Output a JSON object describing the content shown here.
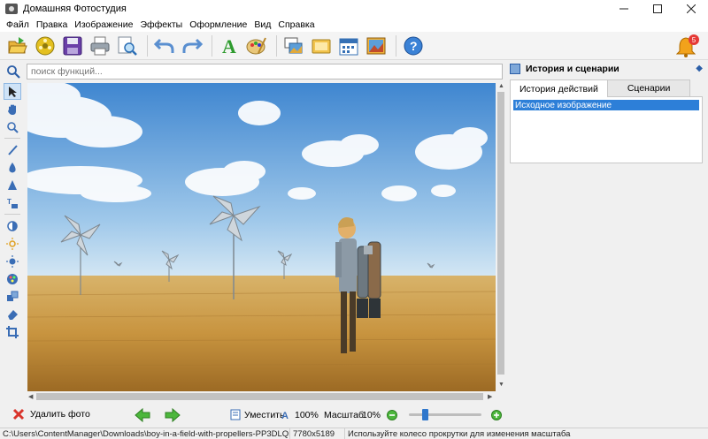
{
  "window": {
    "title": "Домашняя Фотостудия",
    "controls": [
      "minimize",
      "maximize",
      "close"
    ]
  },
  "menu": [
    "Файл",
    "Правка",
    "Изображение",
    "Эффекты",
    "Оформление",
    "Вид",
    "Справка"
  ],
  "toolbar": {
    "buttons": [
      "open-icon",
      "film-icon",
      "save-icon",
      "print-icon",
      "preview-icon",
      "undo-icon",
      "redo-icon",
      "text-icon",
      "palette-icon",
      "frame-icon",
      "card-icon",
      "calendar-icon",
      "collage-icon",
      "help-icon"
    ],
    "notifications_count": "5"
  },
  "search": {
    "placeholder": "поиск функций..."
  },
  "left_tools": [
    "select-icon",
    "hand-icon",
    "zoom-icon",
    "brush-icon",
    "drop-icon",
    "sharpen-icon",
    "text-size-icon",
    "contrast-icon",
    "brightness-icon",
    "sun-icon",
    "color-icon",
    "clone-icon",
    "eraser-icon",
    "crop-icon"
  ],
  "colors": {
    "accent": "#2d7fd8",
    "sky": "#5b9bd8",
    "field": "#c99a45"
  },
  "right_panel": {
    "title": "История и сценарии",
    "tabs": [
      "История действий",
      "Сценарии"
    ],
    "active_tab": "История действий",
    "history_items": [
      "Исходное изображение"
    ]
  },
  "bottom": {
    "delete_label": "Удалить фото",
    "fit_label": "Уместить",
    "actual_label": "100%",
    "scale_label": "Масштаб:",
    "scale_value": "10%",
    "zoom_level": 0.2
  },
  "status": {
    "path": "C:\\Users\\ContentManager\\Downloads\\boy-in-a-field-with-propellers-PP3DLQF.jpg",
    "dimensions": "7780x5189",
    "hint": "Используйте колесо прокрутки для изменения масштаба"
  }
}
